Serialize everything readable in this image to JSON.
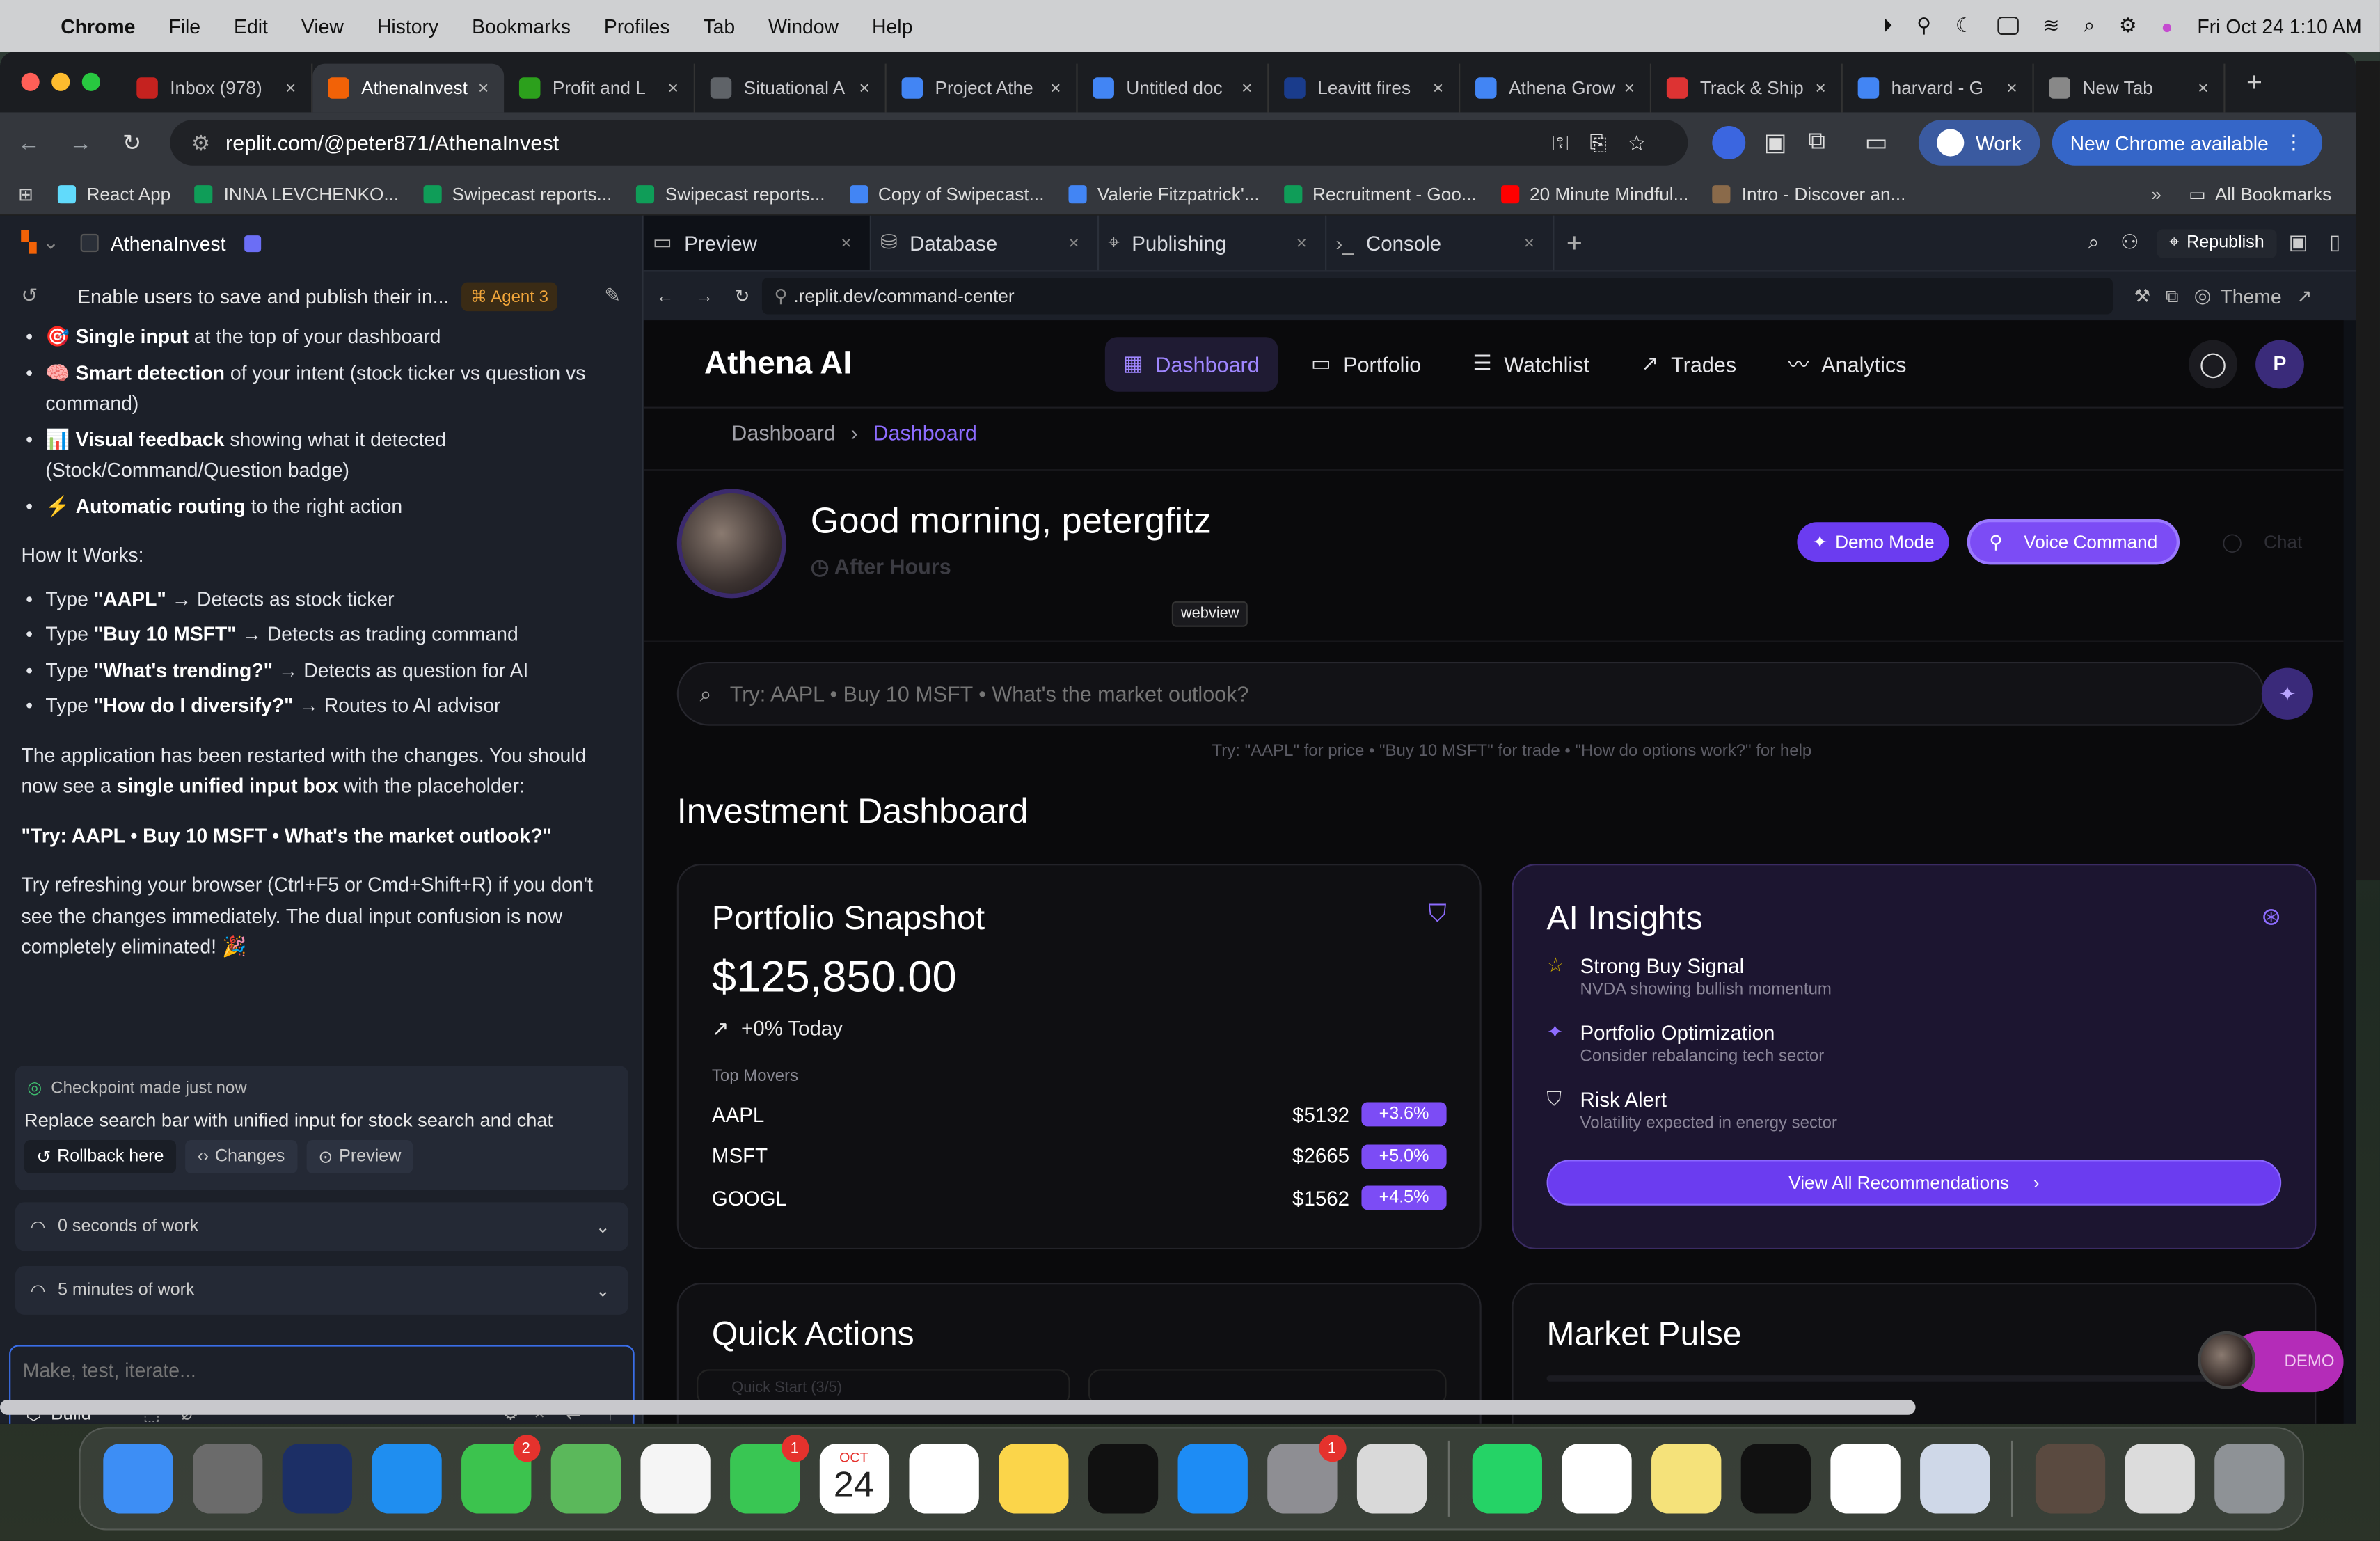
{
  "menubar": {
    "app": "Chrome",
    "items": [
      "File",
      "Edit",
      "View",
      "History",
      "Bookmarks",
      "Profiles",
      "Tab",
      "Window",
      "Help"
    ],
    "datetime": "Fri Oct 24  1:10 AM"
  },
  "chrome": {
    "tabs": [
      {
        "title": "Inbox (978)",
        "color": "#c5221f"
      },
      {
        "title": "AthenaInvest",
        "color": "#f26207"
      },
      {
        "title": "Profit and L",
        "color": "#2ca01c"
      },
      {
        "title": "Situational A",
        "color": "#5f6368"
      },
      {
        "title": "Project Athe",
        "color": "#4285f4"
      },
      {
        "title": "Untitled doc",
        "color": "#4285f4"
      },
      {
        "title": "Leavitt fires",
        "color": "#1a3c8c"
      },
      {
        "title": "Athena Grow",
        "color": "#4285f4"
      },
      {
        "title": "Track & Ship",
        "color": "#d33"
      },
      {
        "title": "harvard - G",
        "color": "#4285f4"
      },
      {
        "title": "New Tab",
        "color": "#888"
      }
    ],
    "url": "replit.com/@peter871/AthenaInvest",
    "profile": "Work",
    "update": "New Chrome available",
    "bookmarks": [
      {
        "label": "React App",
        "color": "#61dafb"
      },
      {
        "label": "INNA LEVCHENKO...",
        "color": "#0f9d58"
      },
      {
        "label": "Swipecast reports...",
        "color": "#0f9d58"
      },
      {
        "label": "Swipecast reports...",
        "color": "#0f9d58"
      },
      {
        "label": "Copy of Swipecast...",
        "color": "#4285f4"
      },
      {
        "label": "Valerie Fitzpatrick'...",
        "color": "#4285f4"
      },
      {
        "label": "Recruitment - Goo...",
        "color": "#0f9d58"
      },
      {
        "label": "20 Minute Mindful...",
        "color": "#ff0000"
      },
      {
        "label": "Intro - Discover an...",
        "color": "#8a6a4a"
      }
    ],
    "all_bookmarks": "All Bookmarks"
  },
  "replit": {
    "project": "AthenaInvest",
    "thread_title": "Enable users to save and publish their in...",
    "agent": "Agent 3",
    "bullets": [
      {
        "icon": "🎯",
        "bold": "Single input",
        "rest": " at the top of your dashboard"
      },
      {
        "icon": "🧠",
        "bold": "Smart detection",
        "rest": " of your intent (stock ticker vs question vs command)"
      },
      {
        "icon": "📊",
        "bold": "Visual feedback",
        "rest": " showing what it detected (Stock/Command/Question badge)"
      },
      {
        "icon": "⚡",
        "bold": "Automatic routing",
        "rest": " to the right action"
      }
    ],
    "how_title": "How It Works:",
    "how": [
      {
        "pre": "Type ",
        "bold": "\"AAPL\"",
        "rest": " → Detects as stock ticker"
      },
      {
        "pre": "Type ",
        "bold": "\"Buy 10 MSFT\"",
        "rest": " → Detects as trading command"
      },
      {
        "pre": "Type ",
        "bold": "\"What's trending?\"",
        "rest": " → Detects as question for AI"
      },
      {
        "pre": "Type ",
        "bold": "\"How do I diversify?\"",
        "rest": " → Routes to AI advisor"
      }
    ],
    "restart_pre": "The application has been restarted with the changes. You should now see a ",
    "restart_bold": "single unified input box",
    "restart_post": " with the placeholder:",
    "placeholder_quote": "\"Try: AAPL • Buy 10 MSFT • What's the market outlook?\"",
    "refresh_note": "Try refreshing your browser (Ctrl+F5 or Cmd+Shift+R) if you don't see the changes immediately. The dual input confusion is now completely eliminated! 🎉",
    "checkpoint": "Checkpoint made just now",
    "checkpoint_desc": "Replace search bar with unified input for stock search and chat",
    "rollback": "Rollback here",
    "changes": "Changes",
    "preview_btn": "Preview",
    "work1": "0 seconds of work",
    "work2": "5 minutes of work",
    "input_placeholder": "Make, test, iterate...",
    "build": "Build",
    "rtabs": [
      "Preview",
      "Database",
      "Publishing",
      "Console"
    ],
    "republish": "Republish",
    "webview_url": ".replit.dev/command-center",
    "theme": "Theme"
  },
  "app": {
    "logo": "Athena AI",
    "nav": [
      {
        "icon": "▦",
        "label": "Dashboard",
        "active": true
      },
      {
        "icon": "▭",
        "label": "Portfolio"
      },
      {
        "icon": "☰",
        "label": "Watchlist"
      },
      {
        "icon": "↗",
        "label": "Trades"
      },
      {
        "icon": "〰",
        "label": "Analytics"
      }
    ],
    "user_initial": "P",
    "breadcrumb": [
      "Dashboard",
      "Dashboard"
    ],
    "greeting": "Good morning, petergfitz",
    "market_status": "After Hours",
    "demo_mode": "Demo Mode",
    "voice_command": "Voice Command",
    "chat": "Chat",
    "tooltip": "webview",
    "search_placeholder": "Try: AAPL • Buy 10 MSFT • What's the market outlook?",
    "search_hint": "Try: \"AAPL\" for price • \"Buy 10 MSFT\" for trade • \"How do options work?\" for help",
    "section_title": "Investment Dashboard",
    "snapshot": {
      "title": "Portfolio Snapshot",
      "value": "$125,850.00",
      "change": "+0% Today",
      "movers_title": "Top Movers",
      "movers": [
        {
          "sym": "AAPL",
          "price": "$5132",
          "chg": "+3.6%"
        },
        {
          "sym": "MSFT",
          "price": "$2665",
          "chg": "+5.0%"
        },
        {
          "sym": "GOOGL",
          "price": "$1562",
          "chg": "+4.5%"
        }
      ]
    },
    "insights": {
      "title": "AI Insights",
      "items": [
        {
          "title": "Strong Buy Signal",
          "sub": "NVDA showing bullish momentum",
          "icon": "☆"
        },
        {
          "title": "Portfolio Optimization",
          "sub": "Consider rebalancing tech sector",
          "icon": "✦"
        },
        {
          "title": "Risk Alert",
          "sub": "Volatility expected in energy sector",
          "icon": "⛉"
        }
      ],
      "cta": "View All Recommendations"
    },
    "quick_actions": "Quick Actions",
    "quick_start": "Quick Start (3/5)",
    "market_pulse": "Market Pulse",
    "demo_badge": "DEMO"
  },
  "dock": {
    "apps": [
      {
        "name": "finder",
        "color": "#3d8ef5"
      },
      {
        "name": "launchpad",
        "color": "#6b6b6b"
      },
      {
        "name": "pilot",
        "color": "#1c2f66"
      },
      {
        "name": "safari",
        "color": "#1f8ef0"
      },
      {
        "name": "messages",
        "color": "#3cc34e",
        "badge": "2"
      },
      {
        "name": "maps",
        "color": "#5bb85b"
      },
      {
        "name": "photos",
        "color": "#f5f5f5"
      },
      {
        "name": "facetime",
        "color": "#39c653",
        "badge": "1"
      },
      {
        "name": "calendar",
        "color": "#ffffff"
      },
      {
        "name": "reminders",
        "color": "#ffffff"
      },
      {
        "name": "notes",
        "color": "#fbd54a"
      },
      {
        "name": "appletv",
        "color": "#111111"
      },
      {
        "name": "appstore",
        "color": "#1d8cf5"
      },
      {
        "name": "settings",
        "color": "#8e8e93",
        "badge": "1"
      },
      {
        "name": "iphone-mirroring",
        "color": "#d9d9d9"
      },
      {
        "name": "whatsapp",
        "color": "#25d366"
      },
      {
        "name": "slack",
        "color": "#ffffff"
      },
      {
        "name": "stickies",
        "color": "#f5e27a"
      },
      {
        "name": "spotify",
        "color": "#111111"
      },
      {
        "name": "chrome",
        "color": "#ffffff"
      },
      {
        "name": "preview",
        "color": "#cfd8e8"
      }
    ],
    "calendar_month": "OCT",
    "calendar_day": "24"
  }
}
